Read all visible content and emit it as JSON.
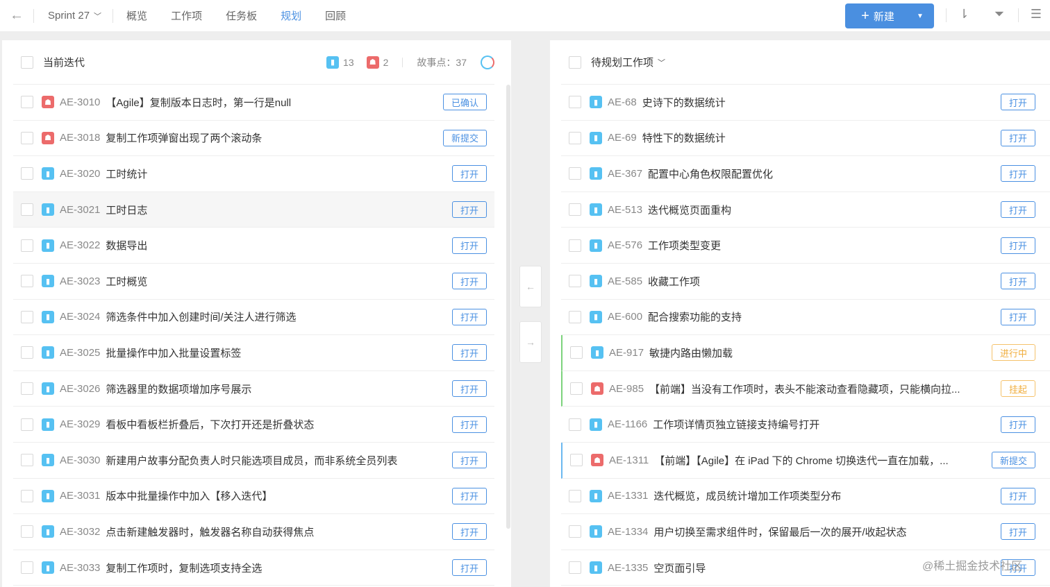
{
  "topbar": {
    "sprint": "Sprint 27",
    "tabs": [
      "概览",
      "工作项",
      "任务板",
      "规划",
      "回顾"
    ],
    "active_tab": 3,
    "new_label": "新建"
  },
  "colors": {
    "accent": "#4a90e2",
    "story": "#56c1f2",
    "bug": "#ec6b6b",
    "warn": "#f0ad3c"
  },
  "left": {
    "title": "当前迭代",
    "story_count": "13",
    "bug_count": "2",
    "points_label": "故事点：37",
    "rows": [
      {
        "type": "bug",
        "key": "AE-3010",
        "title": "【Agile】复制版本日志时，第一行是null",
        "status": "已确认"
      },
      {
        "type": "bug",
        "key": "AE-3018",
        "title": "复制工作项弹窗出现了两个滚动条",
        "status": "新提交"
      },
      {
        "type": "story",
        "key": "AE-3020",
        "title": "工时统计",
        "status": "打开"
      },
      {
        "type": "story",
        "key": "AE-3021",
        "title": "工时日志",
        "status": "打开",
        "hover": true
      },
      {
        "type": "story",
        "key": "AE-3022",
        "title": "数据导出",
        "status": "打开"
      },
      {
        "type": "story",
        "key": "AE-3023",
        "title": "工时概览",
        "status": "打开"
      },
      {
        "type": "story",
        "key": "AE-3024",
        "title": "筛选条件中加入创建时间/关注人进行筛选",
        "status": "打开"
      },
      {
        "type": "story",
        "key": "AE-3025",
        "title": "批量操作中加入批量设置标签",
        "status": "打开"
      },
      {
        "type": "story",
        "key": "AE-3026",
        "title": "筛选器里的数据项增加序号展示",
        "status": "打开"
      },
      {
        "type": "story",
        "key": "AE-3029",
        "title": "看板中看板栏折叠后，下次打开还是折叠状态",
        "status": "打开"
      },
      {
        "type": "story",
        "key": "AE-3030",
        "title": "新建用户故事分配负责人时只能选项目成员，而非系统全员列表",
        "status": "打开"
      },
      {
        "type": "story",
        "key": "AE-3031",
        "title": "版本中批量操作中加入【移入迭代】",
        "status": "打开"
      },
      {
        "type": "story",
        "key": "AE-3032",
        "title": "点击新建触发器时，触发器名称自动获得焦点",
        "status": "打开"
      },
      {
        "type": "story",
        "key": "AE-3033",
        "title": "复制工作项时，复制选项支持全选",
        "status": "打开"
      }
    ]
  },
  "right": {
    "title": "待规划工作项",
    "rows": [
      {
        "type": "story",
        "key": "AE-68",
        "title": "史诗下的数据统计",
        "status": "打开"
      },
      {
        "type": "story",
        "key": "AE-69",
        "title": "特性下的数据统计",
        "status": "打开"
      },
      {
        "type": "story",
        "key": "AE-367",
        "title": "配置中心角色权限配置优化",
        "status": "打开"
      },
      {
        "type": "story",
        "key": "AE-513",
        "title": "迭代概览页面重构",
        "status": "打开"
      },
      {
        "type": "story",
        "key": "AE-576",
        "title": "工作项类型变更",
        "status": "打开"
      },
      {
        "type": "story",
        "key": "AE-585",
        "title": "收藏工作项",
        "status": "打开"
      },
      {
        "type": "story",
        "key": "AE-600",
        "title": "配合搜索功能的支持",
        "status": "打开"
      },
      {
        "type": "story",
        "key": "AE-917",
        "title": "敏捷内路由懒加载",
        "status": "进行中",
        "warn": true,
        "mark": "green"
      },
      {
        "type": "bug",
        "key": "AE-985",
        "title": "【前端】当没有工作项时，表头不能滚动查看隐藏项，只能横向拉...",
        "status": "挂起",
        "warn": true,
        "mark": "green"
      },
      {
        "type": "story",
        "key": "AE-1166",
        "title": "工作项详情页独立链接支持编号打开",
        "status": "打开"
      },
      {
        "type": "bug",
        "key": "AE-1311",
        "title": "【前端】【Agile】在 iPad 下的 Chrome 切换迭代一直在加载，...",
        "status": "新提交",
        "mark": "blue"
      },
      {
        "type": "story",
        "key": "AE-1331",
        "title": "迭代概览，成员统计增加工作项类型分布",
        "status": "打开"
      },
      {
        "type": "story",
        "key": "AE-1334",
        "title": "用户切换至需求组件时，保留最后一次的展开/收起状态",
        "status": "打开"
      },
      {
        "type": "story",
        "key": "AE-1335",
        "title": "空页面引导",
        "status": "打开"
      }
    ]
  },
  "watermark": "@稀土掘金技术社区"
}
